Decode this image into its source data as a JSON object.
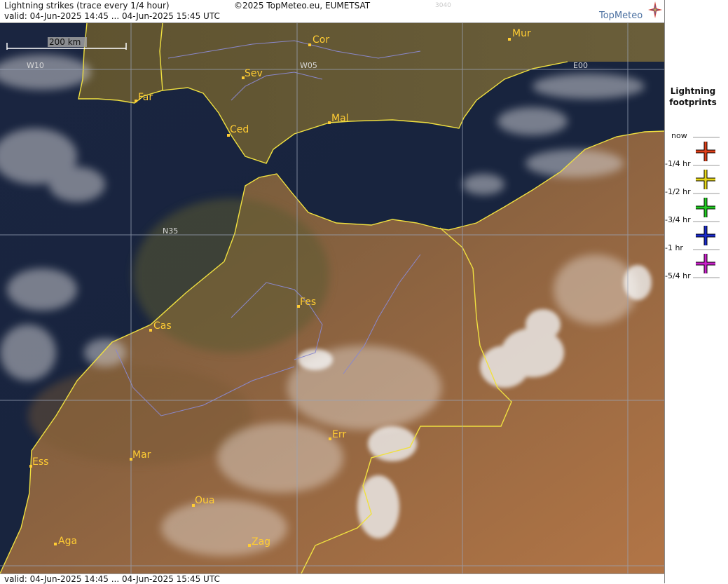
{
  "header": {
    "title": "Lightning strikes (trace every 1/4 hour)",
    "copyright": "©2025 TopMeteo.eu, EUMETSAT",
    "product_code": "3040",
    "valid": "valid:  04-Jun-2025 14:45 ... 04-Jun-2025 15:45 UTC",
    "logo_text": "TopMeteo"
  },
  "footer": {
    "valid": "valid:  04-Jun-2025 14:45 ... 04-Jun-2025 15:45 UTC"
  },
  "map": {
    "scale_label": "200 km",
    "grid_labels": {
      "w10": "W10",
      "w05": "W05",
      "e00": "E00",
      "n35": "N35"
    },
    "cities": {
      "cor": "Cor",
      "mur": "Mur",
      "sev": "Sev",
      "far": "Far",
      "ced": "Ced",
      "mal": "Mal",
      "fes": "Fes",
      "cas": "Cas",
      "err": "Err",
      "ess": "Ess",
      "mar": "Mar",
      "oua": "Oua",
      "aga": "Aga",
      "zag": "Zag"
    }
  },
  "legend": {
    "title_line1": "Lightning",
    "title_line2": "footprints",
    "items": [
      {
        "label": "now",
        "color": "#e0401a"
      },
      {
        "label": "-1/4 hr",
        "color": "#e8d81a"
      },
      {
        "label": "-1/2 hr",
        "color": "#22cc22"
      },
      {
        "label": "-3/4 hr",
        "color": "#1a2acc"
      },
      {
        "label": "-1 hr",
        "color": "#cc22cc"
      },
      {
        "label": "-5/4 hr",
        "color": ""
      }
    ]
  }
}
